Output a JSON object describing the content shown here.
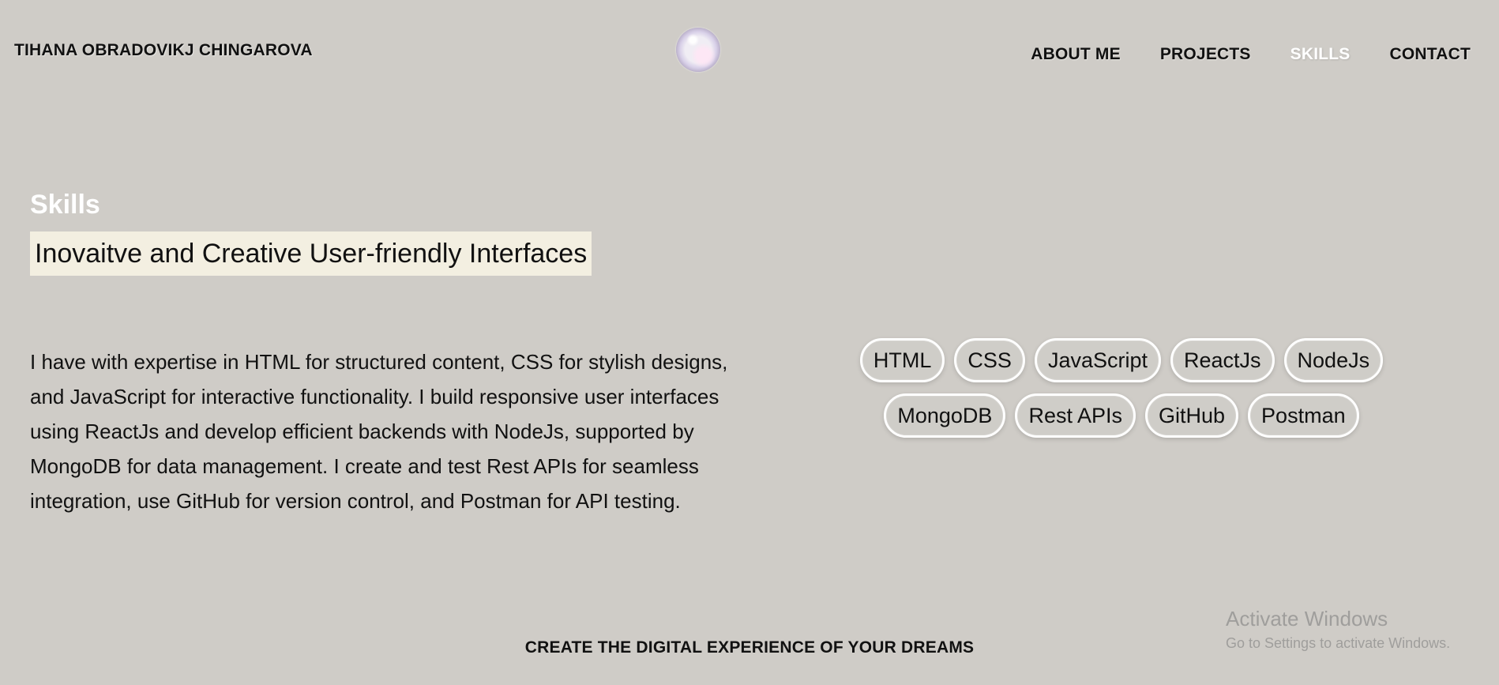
{
  "header": {
    "brand": "TIHANA OBRADOVIKJ CHINGAROVA",
    "logo_icon": "bubble-icon",
    "nav": [
      {
        "label": "ABOUT ME",
        "active": false
      },
      {
        "label": "PROJECTS",
        "active": false
      },
      {
        "label": "SKILLS",
        "active": true
      },
      {
        "label": "CONTACT",
        "active": false
      }
    ]
  },
  "main": {
    "section_label": "Skills",
    "headline": "Inovaitve and Creative User-friendly Interfaces",
    "description": "I have with expertise in HTML for structured content, CSS for stylish designs, and JavaScript for interactive functionality. I build responsive user interfaces using ReactJs and develop efficient backends with NodeJs, supported by MongoDB for data management. I create and test Rest APIs for seamless integration, use GitHub for version control, and Postman for API testing.",
    "skills": [
      "HTML",
      "CSS",
      "JavaScript",
      "ReactJs",
      "NodeJs",
      "MongoDB",
      "Rest APIs",
      "GitHub",
      "Postman"
    ]
  },
  "footer": {
    "tagline": "CREATE THE DIGITAL EXPERIENCE OF YOUR DREAMS"
  },
  "system_overlay": {
    "title": "Activate Windows",
    "subtitle": "Go to Settings to activate Windows."
  },
  "colors": {
    "background": "#cfccc7",
    "active_nav": "#ffffff",
    "headline_highlight": "#f3efe1",
    "chip_border": "#ffffff"
  }
}
